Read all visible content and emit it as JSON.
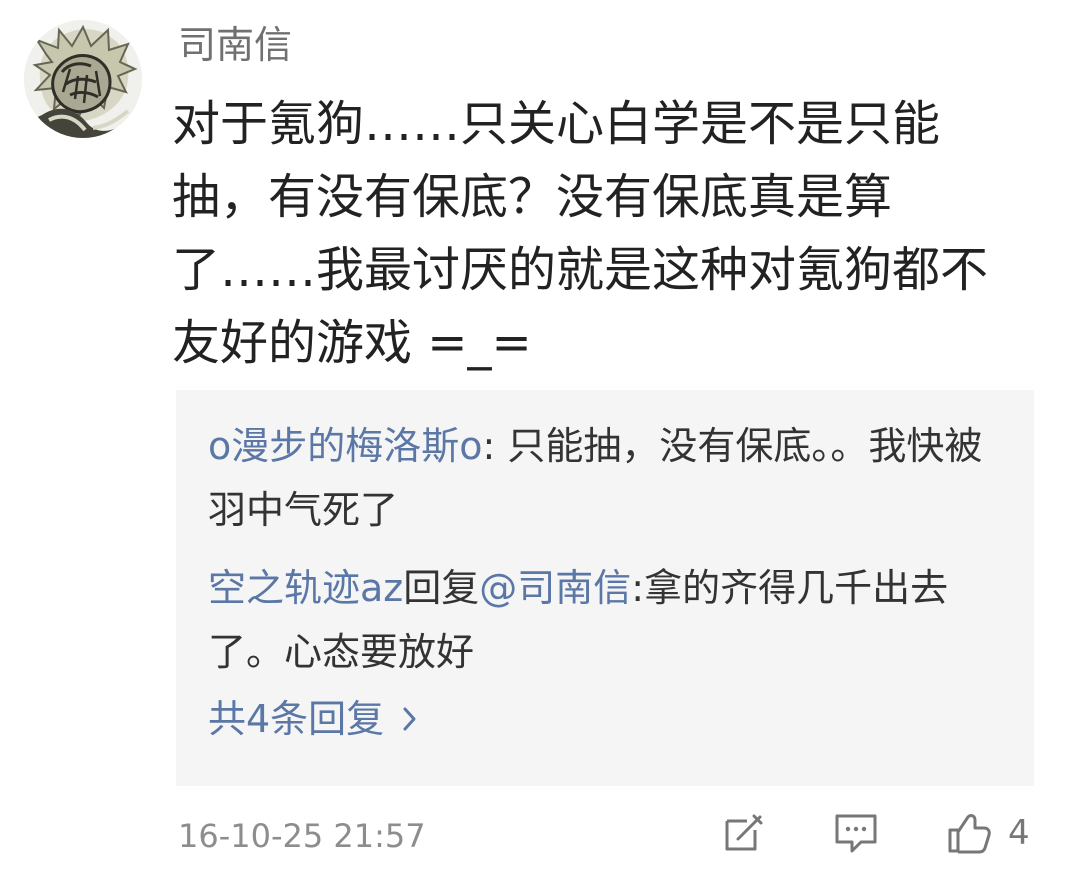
{
  "comment": {
    "username": "司南信",
    "text": "对于氪狗……只关心白学是不是只能抽，有没有保底？没有保底真是算了……我最讨厌的就是这种对氪狗都不友好的游戏 =_=",
    "timestamp": "16-10-25 21:57",
    "like_count": "4"
  },
  "replies": [
    {
      "name": "o漫步的梅洛斯o",
      "text": ": 只能抽，没有保底。。我快被羽中气死了"
    },
    {
      "name": "空之轨迹az",
      "reply_word": "回复",
      "mention": "@司南信",
      "text": ":拿的齐得几千出去了。心态要放好"
    }
  ],
  "more_replies": {
    "label": "共4条回复",
    "icon": "chevron-right-icon"
  },
  "icons": {
    "avatar": "avatar",
    "edit": "edit-icon",
    "comment": "comment-icon",
    "like": "thumbs-up-icon"
  },
  "colors": {
    "link": "#5a77a6",
    "text": "#222222",
    "muted": "#8d8d8d",
    "reply_bg": "#f5f5f5"
  }
}
